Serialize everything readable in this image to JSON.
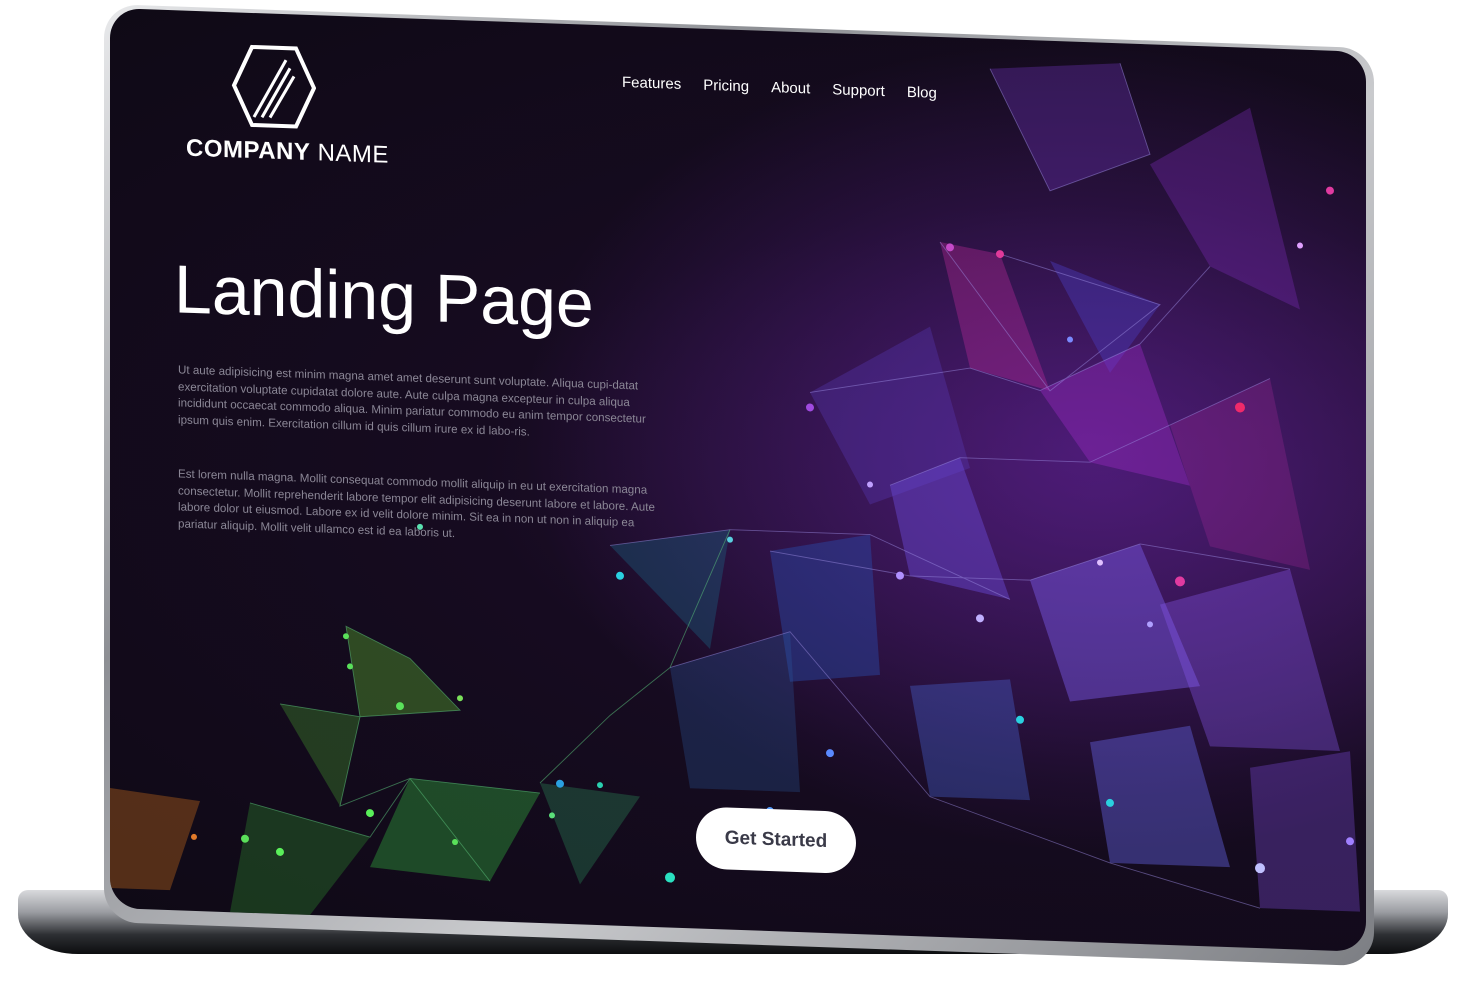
{
  "brand": {
    "name_bold": "COMPANY",
    "name_light": "NAME",
    "logo_icon": "hexagon-logo-icon"
  },
  "nav": {
    "items": [
      "Features",
      "Pricing",
      "About",
      "Support",
      "Blog"
    ]
  },
  "hero": {
    "title": "Landing Page",
    "paragraph_1": "Ut aute adipisicing est minim magna amet amet deserunt sunt voluptate. Aliqua cupi-datat exercitation voluptate cupidatat dolore aute. Aute culpa magna excepteur in culpa aliqua incididunt occaecat commodo aliqua. Minim pariatur commodo eu anim tempor consectetur ipsum quis enim. Exercitation cillum id quis cillum irure ex id labo-ris.",
    "paragraph_2": "Est lorem nulla magna. Mollit consequat commodo mollit aliquip in eu ut exercitation magna consectetur. Mollit reprehenderit labore tempor elit adipisicing deserunt labore et labore. Aute labore dolor ut eiusmod. Labore ex id velit dolore minim. Sit ea in non ut non in aliquip ea pariatur aliquip. Mollit velit ullamco est id ea laboris ut."
  },
  "cta": {
    "label": "Get Started"
  },
  "colors": {
    "background": "#140c1c",
    "accent_purple": "#8a3ad8",
    "accent_magenta": "#c4239a",
    "accent_green": "#3fa63a",
    "accent_cyan": "#2ad0c8"
  }
}
